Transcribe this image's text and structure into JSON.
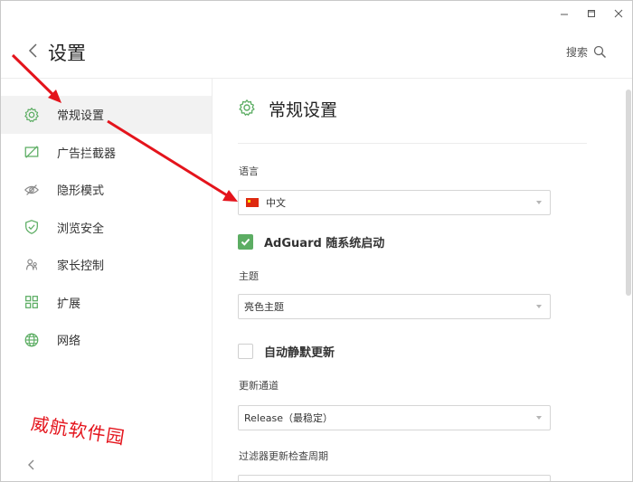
{
  "header": {
    "title": "设置",
    "search_label": "搜索"
  },
  "sidebar": {
    "items": [
      {
        "label": "常规设置",
        "icon": "gear-icon"
      },
      {
        "label": "广告拦截器",
        "icon": "ad-blocker-icon"
      },
      {
        "label": "隐形模式",
        "icon": "eye-off-icon"
      },
      {
        "label": "浏览安全",
        "icon": "shield-check-icon"
      },
      {
        "label": "家长控制",
        "icon": "parental-control-icon"
      },
      {
        "label": "扩展",
        "icon": "extensions-icon"
      },
      {
        "label": "网络",
        "icon": "globe-icon"
      }
    ]
  },
  "main": {
    "section_title": "常规设置",
    "language_label": "语言",
    "language_value": "中文",
    "autostart_label": "AdGuard 随系统启动",
    "autostart_checked": true,
    "theme_label": "主题",
    "theme_value": "亮色主题",
    "silent_update_label": "自动静默更新",
    "silent_update_checked": false,
    "channel_label": "更新通道",
    "channel_value": "Release（最稳定）",
    "filter_update_label": "过滤器更新检查周期"
  },
  "watermark": "威航软件园",
  "colors": {
    "accent": "#5cad63",
    "arrow": "#e4141c",
    "active_bg": "#f2f2f2"
  }
}
